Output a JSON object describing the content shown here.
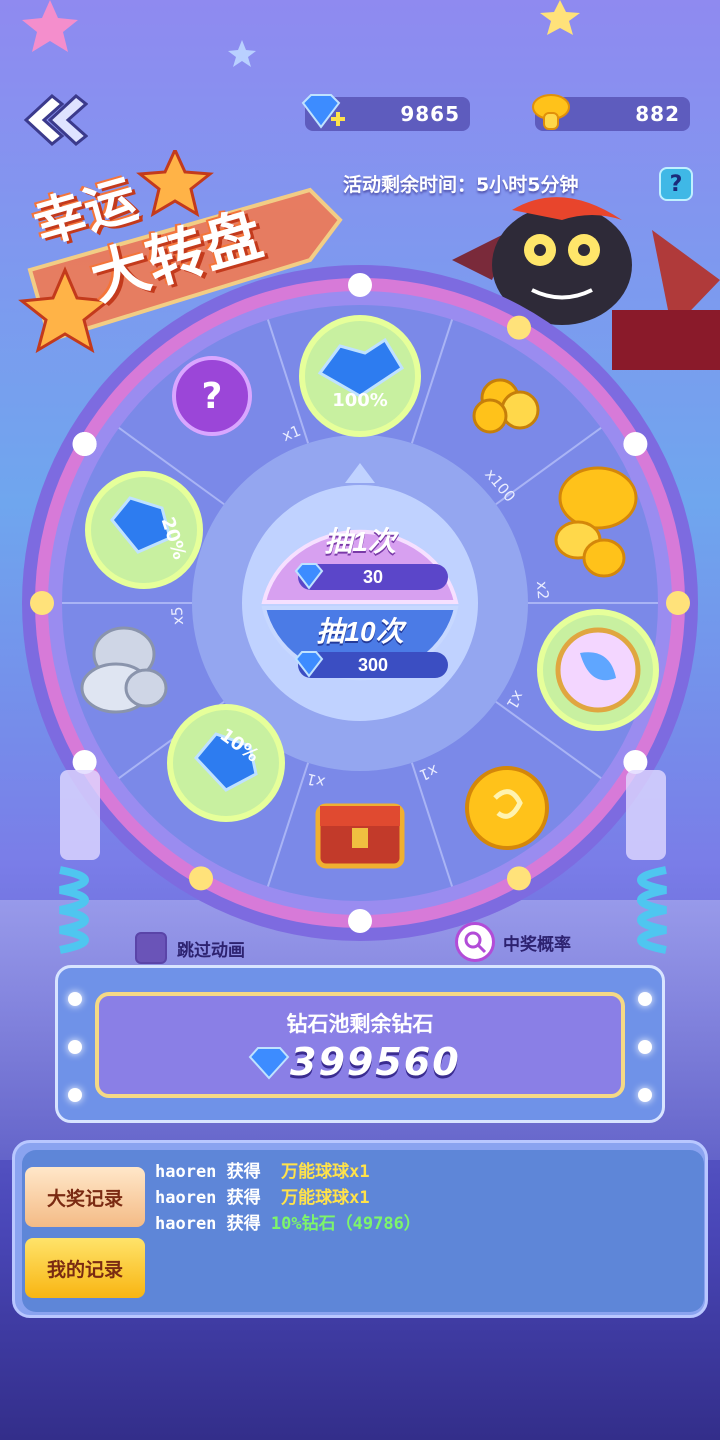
{
  "header": {
    "diamonds": "9865",
    "mushrooms": "882",
    "timer": "活动剩余时间：5小时5分钟",
    "help": "?"
  },
  "title": {
    "line1": "幸运",
    "line2": "大转盘"
  },
  "wheel": {
    "prizes": [
      {
        "icon": "diamond-pile-icon",
        "label": "100%"
      },
      {
        "icon": "gold-coins-icon",
        "label": "x100"
      },
      {
        "icon": "golden-mushroom-icon",
        "label": "x2"
      },
      {
        "icon": "rainbow-orb-icon",
        "label": "x1"
      },
      {
        "icon": "golden-egg-icon",
        "label": "x1"
      },
      {
        "icon": "treasure-chest-icon",
        "label": "x1"
      },
      {
        "icon": "diamond-10-percent-icon",
        "label": "10%"
      },
      {
        "icon": "silver-mushroom-icon",
        "label": "x5"
      },
      {
        "icon": "diamond-20-percent-icon",
        "label": "20%"
      },
      {
        "icon": "mystery-orb-icon",
        "label": "x1"
      }
    ],
    "draw_once": {
      "label": "抽1次",
      "cost": "30"
    },
    "draw_ten": {
      "label": "抽10次",
      "cost": "300"
    }
  },
  "controls": {
    "skip_animation": "跳过动画",
    "odds": "中奖概率"
  },
  "pool": {
    "title": "钻石池剩余钻石",
    "value": "399560"
  },
  "records": {
    "tabs": [
      "大奖记录",
      "我的记录"
    ],
    "entries": [
      {
        "user": "haoren",
        "verb": "获得",
        "item": "万能球球x1",
        "color": "#ffe24a"
      },
      {
        "user": "haoren",
        "verb": "获得",
        "item": "万能球球x1",
        "color": "#ffe24a"
      },
      {
        "user": "haoren",
        "verb": "获得",
        "item": "10%钻石（49786）",
        "color": "#7df56a"
      }
    ]
  },
  "colors": {
    "wheel_rim": "#d86fd8",
    "wheel_face": "#7b89e8",
    "accent_gold": "#f8b512"
  }
}
